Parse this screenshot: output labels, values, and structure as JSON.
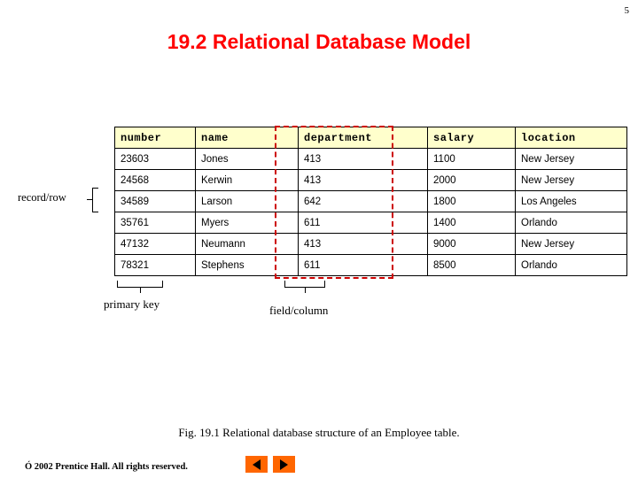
{
  "slide": {
    "number": "5",
    "title": "19.2  Relational Database Model",
    "figure_caption": "Fig. 19.1   Relational database structure of an Employee table.",
    "copyright": "Ó 2002 Prentice Hall. All rights reserved."
  },
  "annotations": {
    "record_row": "record/row",
    "primary_key": "primary key",
    "field_column": "field/column"
  },
  "table": {
    "headers": [
      "number",
      "name",
      "department",
      "salary",
      "location"
    ],
    "rows": [
      [
        "23603",
        "Jones",
        "413",
        "1100",
        "New Jersey"
      ],
      [
        "24568",
        "Kerwin",
        "413",
        "2000",
        "New Jersey"
      ],
      [
        "34589",
        "Larson",
        "642",
        "1800",
        "Los Angeles"
      ],
      [
        "35761",
        "Myers",
        "611",
        "1400",
        "Orlando"
      ],
      [
        "47132",
        "Neumann",
        "413",
        "9000",
        "New Jersey"
      ],
      [
        "78321",
        "Stephens",
        "611",
        "8500",
        "Orlando"
      ]
    ]
  },
  "nav": {
    "prev_icon": "triangle-left-icon",
    "next_icon": "triangle-right-icon"
  },
  "colors": {
    "title": "#ff0000",
    "header_bg": "#ffffcc",
    "highlight": "#cc0000",
    "nav_bg": "#ff6600"
  }
}
